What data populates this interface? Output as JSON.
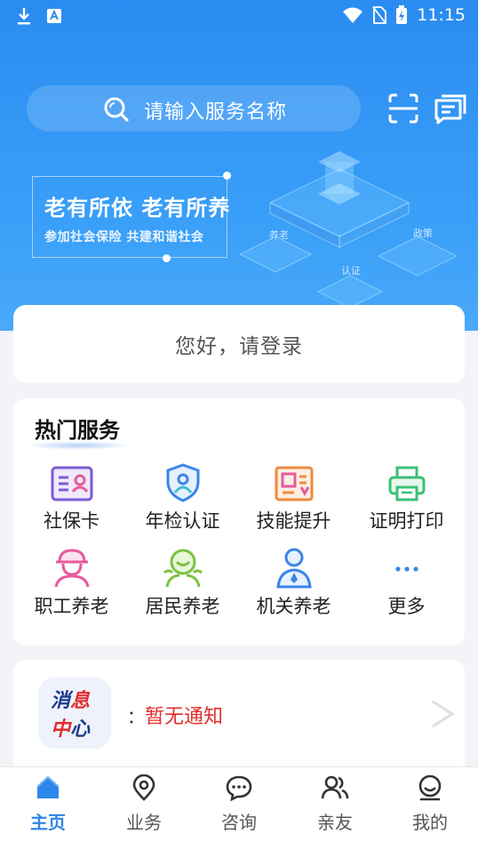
{
  "status_bar": {
    "time": "11:15"
  },
  "search": {
    "placeholder": "请输入服务名称"
  },
  "banner": {
    "title": "老有所依  老有所养",
    "subtitle": "参加社会保险  共建和谐社会",
    "art_labels": [
      "养老",
      "政策",
      "认证"
    ]
  },
  "login": {
    "text": "您好，请登录"
  },
  "hot_services": {
    "title": "热门服务",
    "items": [
      {
        "label": "社保卡",
        "icon": "id-card-icon"
      },
      {
        "label": "年检认证",
        "icon": "shield-user-icon"
      },
      {
        "label": "技能提升",
        "icon": "certificate-icon"
      },
      {
        "label": "证明打印",
        "icon": "printer-icon"
      },
      {
        "label": "职工养老",
        "icon": "worker-icon"
      },
      {
        "label": "居民养老",
        "icon": "resident-icon"
      },
      {
        "label": "机关养老",
        "icon": "official-icon"
      },
      {
        "label": "更多",
        "icon": "more-icon"
      }
    ]
  },
  "notice": {
    "badge_line1": "消息",
    "badge_line2": "中心",
    "colon": "：",
    "text": "暂无通知"
  },
  "tabs": [
    {
      "label": "主页",
      "active": true
    },
    {
      "label": "业务",
      "active": false
    },
    {
      "label": "咨询",
      "active": false
    },
    {
      "label": "亲友",
      "active": false
    },
    {
      "label": "我的",
      "active": false
    }
  ],
  "colors": {
    "primary": "#2f86e9",
    "banner": "#3396f5",
    "notice_red": "#e22d2d",
    "icon_purple": "#7b5bd6",
    "icon_blue": "#3a86e8",
    "icon_orange": "#f08a3c",
    "icon_green": "#3cbf74",
    "icon_pink": "#e85a9a"
  }
}
